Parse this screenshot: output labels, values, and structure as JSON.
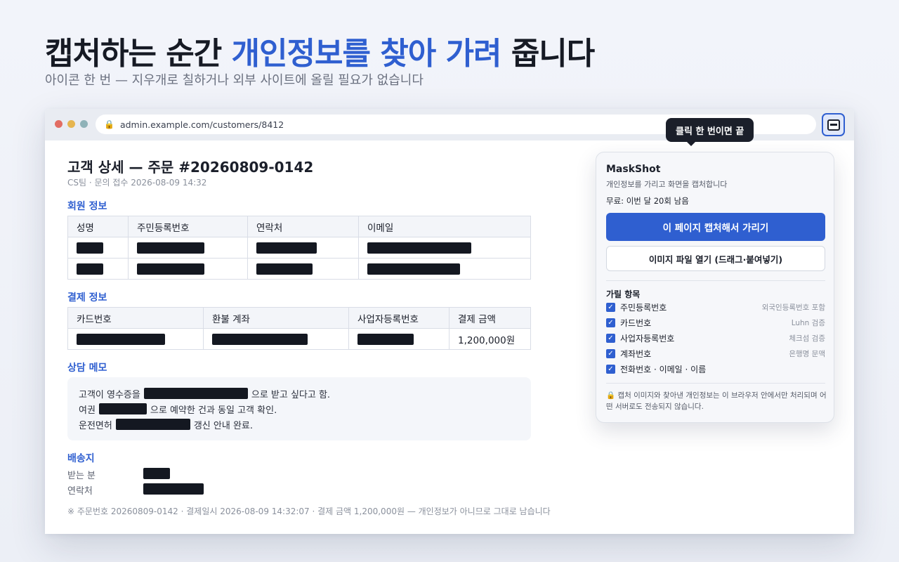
{
  "hero": {
    "title_part1": "캡처하는 순간 ",
    "title_accent": "개인정보를 찾아 가려",
    "title_part2": " 줍니다",
    "subtitle": "아이콘 한 번 — 지우개로 칠하거나 외부 사이트에 올릴 필요가 없습니다"
  },
  "browser": {
    "url": "admin.example.com/customers/8412",
    "extension_icon": "redact-icon"
  },
  "page": {
    "title": "고객 상세 — 주문 #20260809-0142",
    "meta": "CS팀 · 문의 접수 2026-08-09 14:32",
    "member_section": "회원 정보",
    "member_headers": [
      "성명",
      "주민등록번호",
      "연락처",
      "이메일"
    ],
    "payment_section": "결제 정보",
    "payment_headers": [
      "카드번호",
      "환불 계좌",
      "사업자등록번호",
      "결제 금액"
    ],
    "payment_amount": "1,200,000원",
    "memo_section": "상담 메모",
    "memo": {
      "l1_a": "고객이 영수증을",
      "l1_b": "으로 받고 싶다고 함.",
      "l2_a": "여권",
      "l2_b": "으로 예약한 건과 동일 고객 확인.",
      "l3_a": "운전면허",
      "l3_b": "갱신 안내 완료."
    },
    "shipping_section": "배송지",
    "shipping_recipient_label": "받는 분",
    "shipping_phone_label": "연락처",
    "footnote": "※ 주문번호 20260809-0142 · 결제일시 2026-08-09 14:32:07 · 결제 금액 1,200,000원 — 개인정보가 아니므로 그대로 남습니다"
  },
  "popup": {
    "tooltip": "클릭 한 번이면 끝",
    "title": "MaskShot",
    "subtitle": "개인정보를 가리고 화면을 캡처합니다",
    "quota": "무료: 이번 달 20회 남음",
    "primary_button": "이 페이지 캡처해서 가리기",
    "secondary_button": "이미지 파일 열기 (드래그·붙여넣기)",
    "options_heading": "가릴 항목",
    "options": [
      {
        "label": "주민등록번호",
        "note": "외국인등록번호 포함",
        "checked": true
      },
      {
        "label": "카드번호",
        "note": "Luhn 검증",
        "checked": true
      },
      {
        "label": "사업자등록번호",
        "note": "체크섬 검증",
        "checked": true
      },
      {
        "label": "계좌번호",
        "note": "은행명 문맥",
        "checked": true
      },
      {
        "label": "전화번호 · 이메일 · 이름",
        "note": "",
        "checked": true
      }
    ],
    "footer": "캡처 이미지와 찾아낸 개인정보는 이 브라우저 안에서만 처리되며 어떤 서버로도 전송되지 않습니다.",
    "footer_icon": "lock-icon"
  }
}
